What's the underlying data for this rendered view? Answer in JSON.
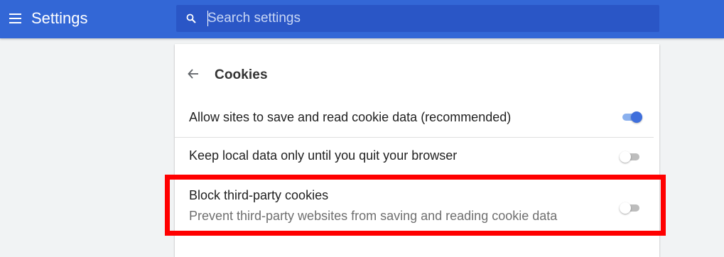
{
  "header": {
    "title": "Settings",
    "menu_icon": "hamburger-menu-icon"
  },
  "search": {
    "placeholder": "Search settings",
    "value": "",
    "icon": "search-icon"
  },
  "subpage": {
    "back_icon": "back-arrow-icon",
    "title": "Cookies"
  },
  "settings": [
    {
      "label": "Allow sites to save and read cookie data (recommended)",
      "enabled": true
    },
    {
      "label": "Keep local data only until you quit your browser",
      "enabled": false
    },
    {
      "label": "Block third-party cookies",
      "sublabel": "Prevent third-party websites from saving and reading cookie data",
      "enabled": false,
      "highlighted": true
    }
  ],
  "colors": {
    "header_bg": "#3367d6",
    "search_bg": "#2a56c6",
    "toggle_on": "#3f6fdc",
    "toggle_off_track": "#bdbdbd",
    "highlight_border": "#ff0000"
  }
}
